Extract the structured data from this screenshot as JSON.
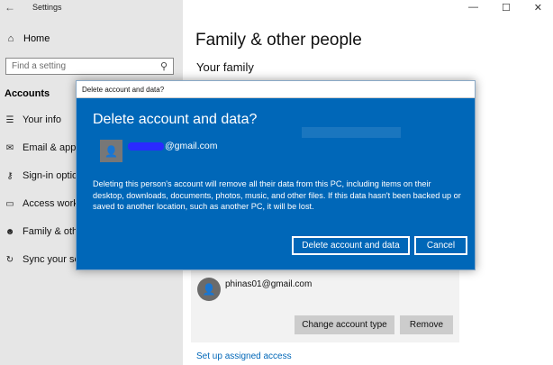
{
  "app": {
    "title": "Settings",
    "back_icon": "back-arrow-icon",
    "window_controls": [
      "minimize-icon",
      "maximize-icon",
      "close-icon"
    ]
  },
  "sidebar": {
    "home_label": "Home",
    "search": {
      "placeholder": "Find a setting"
    },
    "section_title": "Accounts",
    "items": [
      {
        "label": "Your info",
        "icon": "person-card-icon"
      },
      {
        "label": "Email & app a",
        "icon": "mail-icon"
      },
      {
        "label": "Sign-in option",
        "icon": "key-icon"
      },
      {
        "label": "Access work c",
        "icon": "briefcase-icon"
      },
      {
        "label": "Family & othe",
        "icon": "people-icon"
      },
      {
        "label": "Sync your setti",
        "icon": "sync-icon"
      }
    ]
  },
  "main": {
    "title": "Family & other people",
    "subtitle": "Your family",
    "account": {
      "email": "phinas01@gmail.com",
      "change_type_label": "Change account type",
      "remove_label": "Remove"
    },
    "link_label": "Set up assigned access"
  },
  "dialog": {
    "window_title": "Delete account and data?",
    "heading": "Delete account and data?",
    "email": "@gmail.com",
    "body": "Deleting this person's account will remove all their data from this PC, including items on their desktop, downloads, documents, photos, music, and other files. If this data hasn't been backed up or saved to another location, such as another PC, it will be lost.",
    "confirm_label": "Delete account and data",
    "cancel_label": "Cancel"
  },
  "colors": {
    "accent": "#0067b8",
    "sidebar_bg": "#e6e6e6",
    "link": "#0067b8"
  }
}
